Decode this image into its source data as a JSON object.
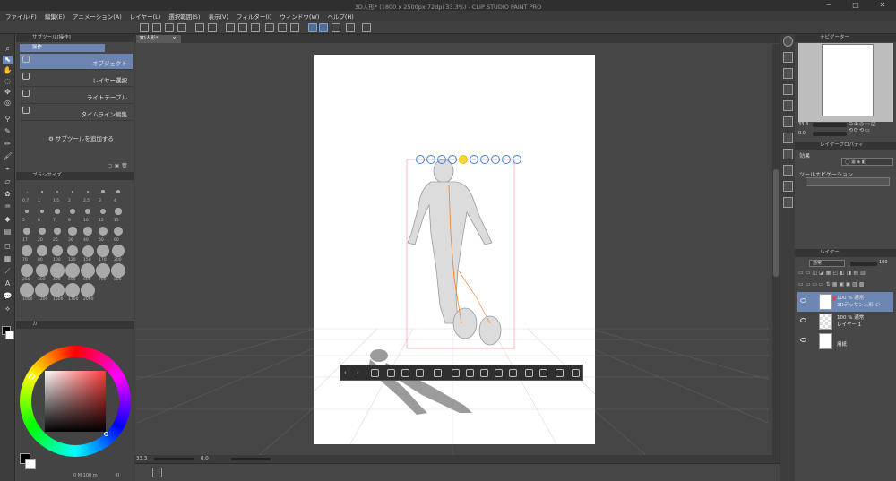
{
  "title": "3D人形* (1800 x 2500px 72dpi 33.3%)  - CLIP STUDIO PAINT PRO",
  "window_controls": {
    "minimize": "─",
    "maximize": "□",
    "close": "✕"
  },
  "menu": [
    "ファイル(F)",
    "編集(E)",
    "アニメーション(A)",
    "レイヤー(L)",
    "選択範囲(S)",
    "表示(V)",
    "フィルター(I)",
    "ウィンドウ(W)",
    "ヘルプ(H)"
  ],
  "subtool": {
    "header": "サブツール[操作]",
    "tab": "操作",
    "items": [
      "オブジェクト",
      "レイヤー選択",
      "ライトテーブル",
      "タイムライン編集"
    ],
    "add": "サブツールを追加する"
  },
  "brush": {
    "header": "ブラシサイズ",
    "sizes": [
      "0.7",
      "1",
      "1.5",
      "2",
      "2.5",
      "3",
      "4",
      "5",
      "6",
      "7",
      "8",
      "10",
      "12",
      "15",
      "17",
      "20",
      "25",
      "30",
      "40",
      "50",
      "60",
      "70",
      "80",
      "100",
      "120",
      "150",
      "170",
      "200",
      "250",
      "300",
      "400",
      "500",
      "600",
      "700",
      "800",
      "1000",
      "1200",
      "1500",
      "1700",
      "2000"
    ]
  },
  "color": {
    "tabs": [
      "カ",
      "カ"
    ],
    "main": "#000000",
    "sub": "#ffffff",
    "hue_square_top": "#ff3b3b",
    "readout": "0 M 100 m",
    "readout2": "0"
  },
  "document": {
    "tab": "3D人形*",
    "close": "×"
  },
  "canvas": {
    "bg": "#ffffff",
    "zoom": "33.3",
    "angle": "0.0"
  },
  "navigator": {
    "header": "ナビゲーター",
    "zoom": "33.3",
    "angle": "0.0"
  },
  "layer_property": {
    "header": "レイヤープロパティ",
    "effect": "効果",
    "tool_nav": "ツールナビゲーション"
  },
  "layers": {
    "header": "レイヤー",
    "blend": "通常",
    "opacity": "100",
    "items": [
      {
        "line1": "100 % 通常",
        "line2": "3Dデッサン人形-ジ"
      },
      {
        "line1": "100 % 通常",
        "line2": "レイヤー 1"
      },
      {
        "line1": "",
        "line2": "用紙"
      }
    ]
  }
}
